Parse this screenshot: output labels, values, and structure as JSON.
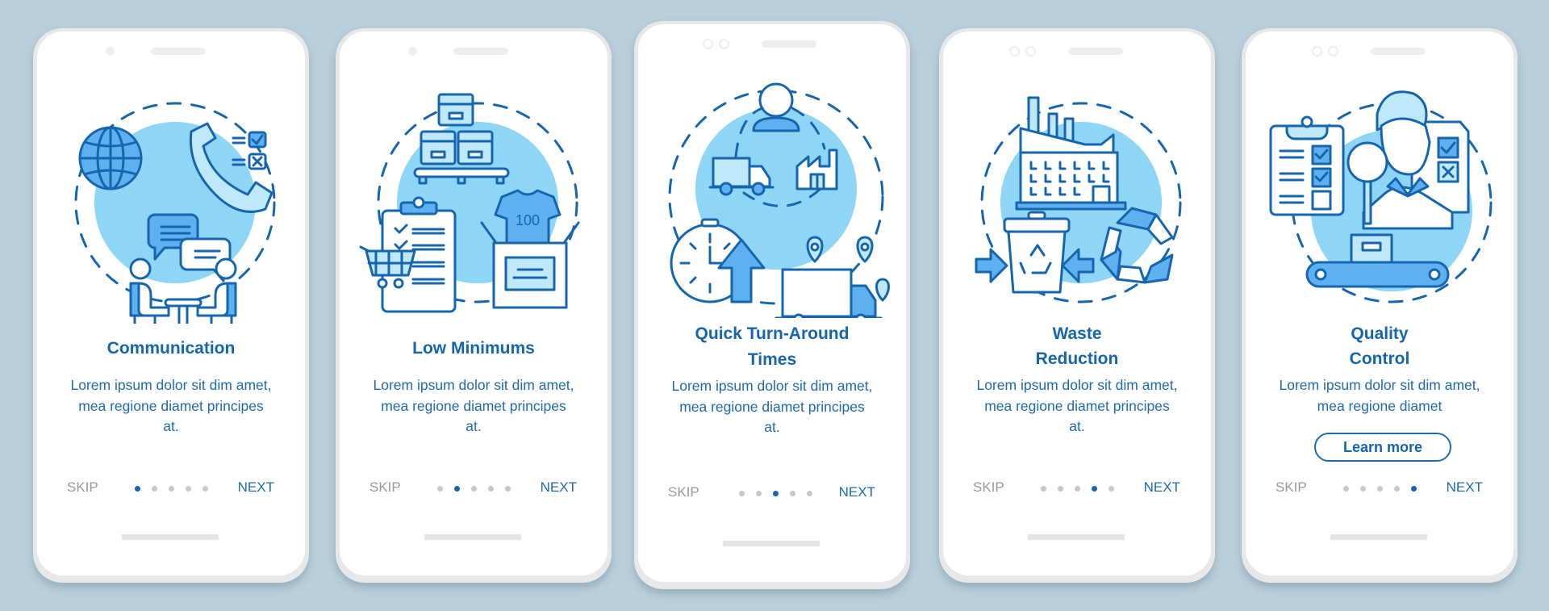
{
  "colors": {
    "background": "#b9cfdb",
    "accent": "#1565b0",
    "illustration_fill": "#8fd6f6",
    "skip_gray": "#9a9a9a",
    "dot_inactive": "#c8c8c8"
  },
  "screens": [
    {
      "title": "Communication",
      "body": "Lorem ipsum dolor sit dim amet, mea regione diamet principes at.",
      "skip": "SKIP",
      "next": "NEXT",
      "active_page": 1,
      "total_pages": 5,
      "illustration": "communication-illustration"
    },
    {
      "title": "Low Minimums",
      "body": "Lorem ipsum dolor sit dim amet, mea regione diamet principes at.",
      "skip": "SKIP",
      "next": "NEXT",
      "active_page": 2,
      "total_pages": 5,
      "illustration": "low-minimums-illustration",
      "shirt_label": "100"
    },
    {
      "title": "Quick Turn-Around Times",
      "body": "Lorem ipsum dolor sit dim amet, mea regione diamet principes at.",
      "skip": "SKIP",
      "next": "NEXT",
      "active_page": 3,
      "total_pages": 5,
      "illustration": "quick-turnaround-illustration"
    },
    {
      "title": "Waste Reduction",
      "body": "Lorem ipsum dolor sit dim amet, mea regione diamet principes at.",
      "skip": "SKIP",
      "next": "NEXT",
      "active_page": 4,
      "total_pages": 5,
      "illustration": "waste-reduction-illustration"
    },
    {
      "title": "Quality Control",
      "body": "Lorem ipsum dolor sit dim amet, mea regione diamet",
      "skip": "SKIP",
      "next": "NEXT",
      "active_page": 5,
      "total_pages": 5,
      "illustration": "quality-control-illustration",
      "button": "Learn more"
    }
  ]
}
